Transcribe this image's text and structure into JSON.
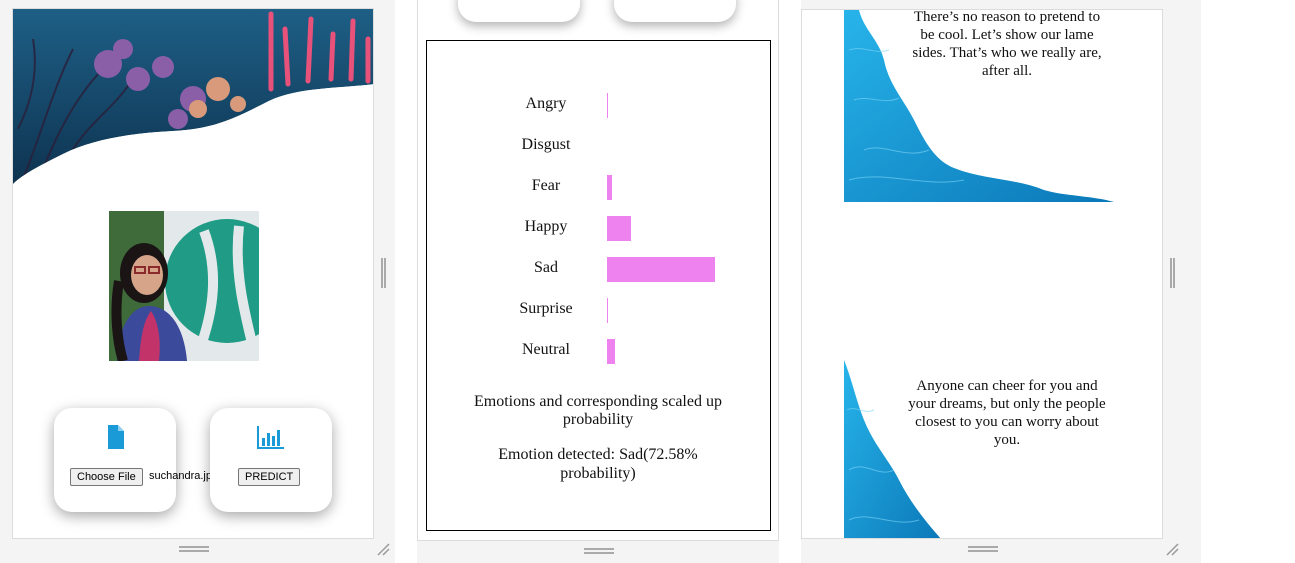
{
  "upload": {
    "choose_label": "Choose File",
    "file_name": "suchandra.jpg",
    "predict_label": "PREDICT",
    "file_icon": "file-icon",
    "chart_icon": "bar-chart-icon"
  },
  "chart_data": {
    "type": "bar",
    "orientation": "horizontal",
    "categories": [
      "Angry",
      "Disgust",
      "Fear",
      "Happy",
      "Sad",
      "Surprise",
      "Neutral"
    ],
    "values": [
      0.5,
      0,
      2.5,
      12,
      54,
      0.5,
      4
    ],
    "xlim": [
      0,
      100
    ],
    "bar_color": "#ee82ee",
    "caption": "Emotions and corresponding scaled up probability",
    "title": "",
    "xlabel": "",
    "ylabel": ""
  },
  "result": {
    "detected": "Emotion detected: Sad(72.58% probability)"
  },
  "quotes": {
    "first": "There’s no reason to pretend to be cool. Let’s show our lame sides. That’s who we really are, after all.",
    "second": "Anyone can cheer for you and your dreams, but only the people closest to you can worry about you."
  },
  "colors": {
    "accent": "#1a9bd7",
    "water": "#1b9fd8"
  }
}
